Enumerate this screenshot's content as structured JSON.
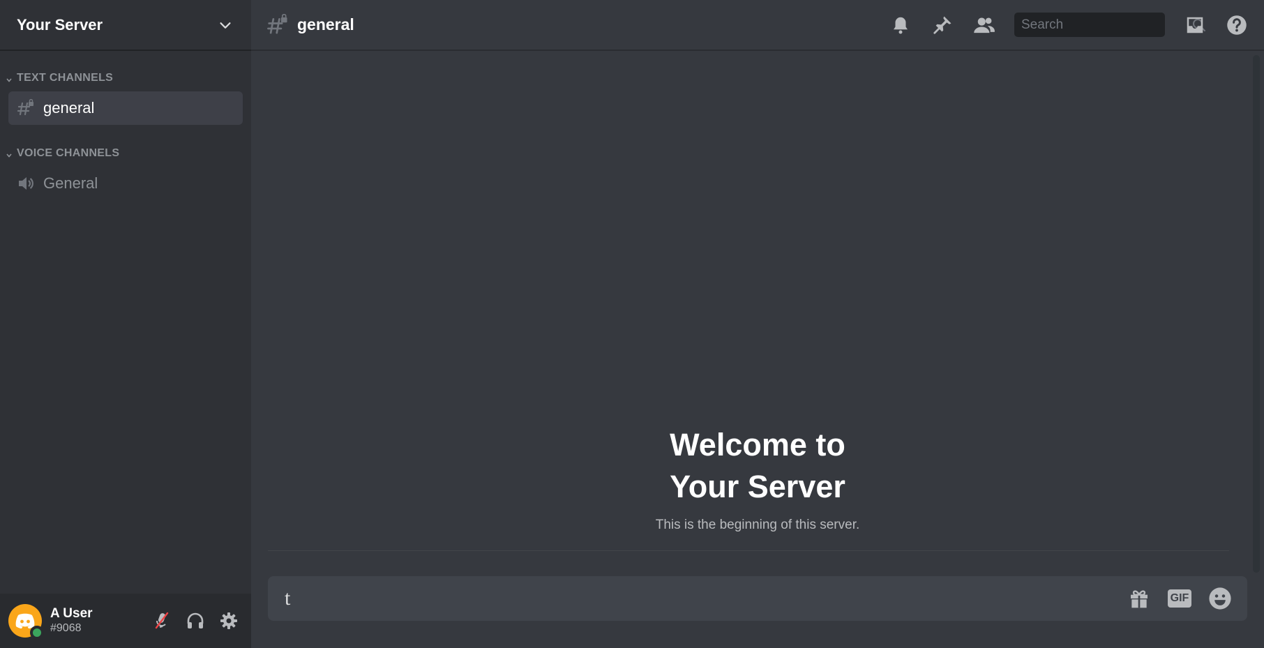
{
  "server": {
    "name": "Your Server"
  },
  "categories": {
    "text": {
      "label": "TEXT CHANNELS"
    },
    "voice": {
      "label": "VOICE CHANNELS"
    }
  },
  "channels": {
    "text": [
      {
        "name": "general",
        "active": true
      }
    ],
    "voice": [
      {
        "name": "General"
      }
    ]
  },
  "user": {
    "name": "A User",
    "tag": "#9068",
    "status_color": "#3ba55d",
    "avatar_color": "#faa61a"
  },
  "topbar": {
    "channel_name": "general",
    "search_placeholder": "Search",
    "icons": [
      "bell-icon",
      "pin-icon",
      "members-icon",
      "inbox-icon",
      "help-icon"
    ]
  },
  "welcome": {
    "title_line1": "Welcome to",
    "title_line2": "Your Server",
    "subtitle": "This is the beginning of this server."
  },
  "composer": {
    "value": "t",
    "gif_label": "GIF"
  },
  "colors": {
    "sidebar": "#2f3136",
    "main": "#36393f",
    "user_panel": "#292b2f",
    "input": "#40444b"
  }
}
